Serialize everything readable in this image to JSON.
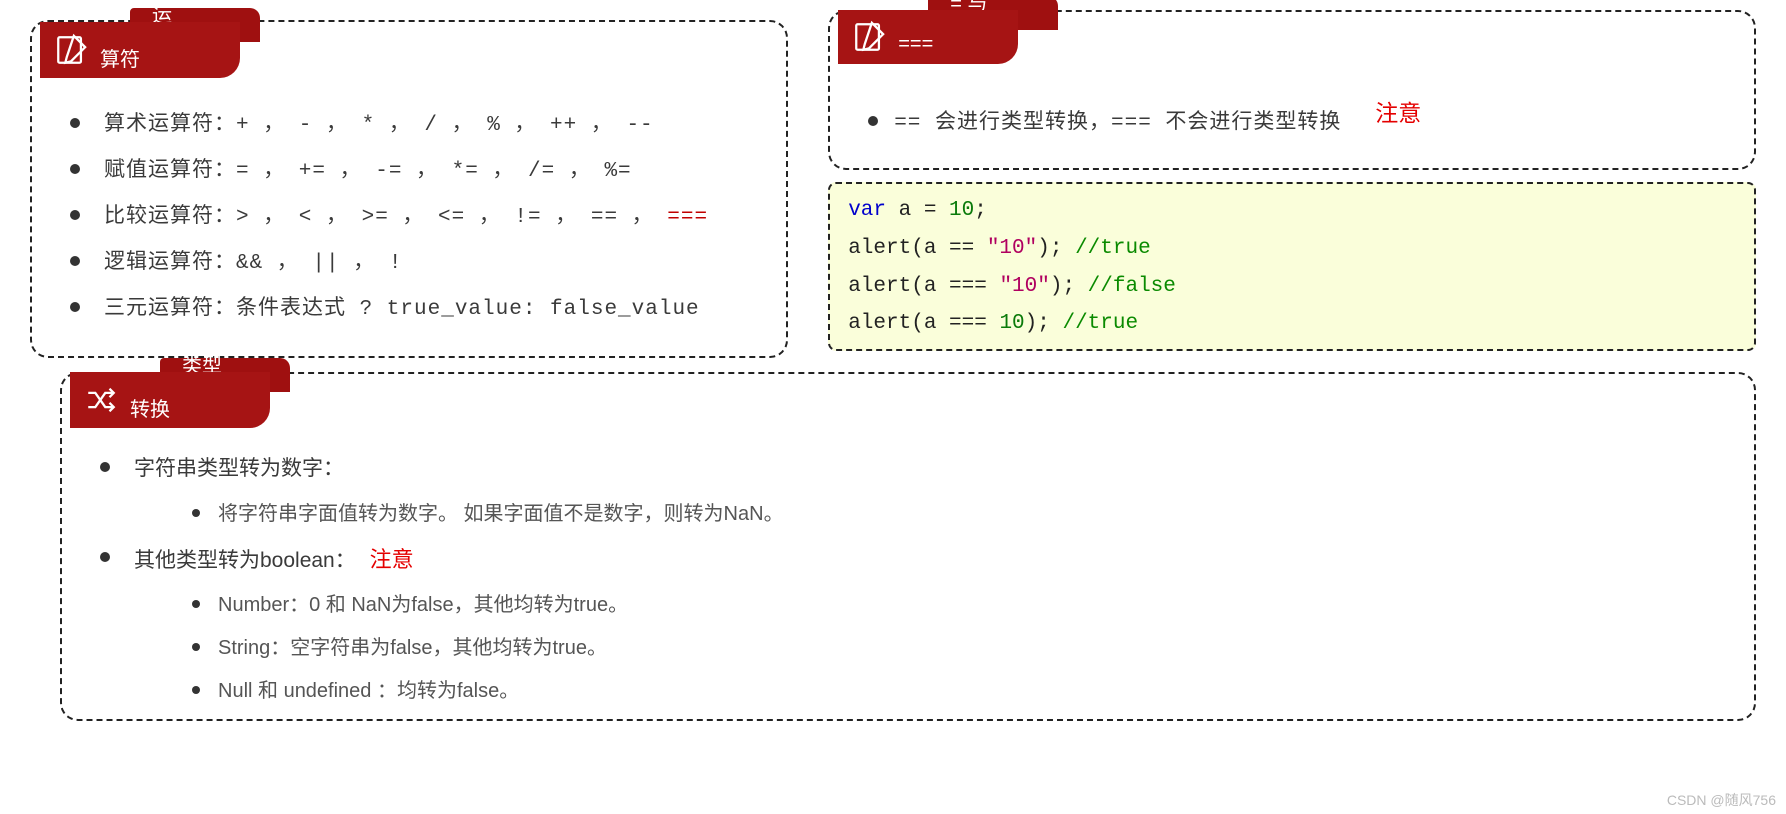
{
  "watermark": "CSDN @随风756",
  "box1": {
    "tab_back": "运",
    "tab_front": "算符",
    "items": {
      "arith_label": "算术运算符：",
      "arith_ops": "+ ， - ， * ， / ， % ， ++ ， --",
      "assign_label": "赋值运算符：",
      "assign_ops": "= ， += ， -= ， *= ， /= ， %=",
      "compare_label": "比较运算符：",
      "compare_ops_main": "> ， < ， >= ， <= ， != ， == ， ",
      "compare_ops_red": "===",
      "logic_label": "逻辑运算符：",
      "logic_ops": "&& ， || ， !",
      "ternary_label": "三元运算符：",
      "ternary_ops": "条件表达式 ? true_value: false_value"
    }
  },
  "box2": {
    "tab_back": "= 与",
    "tab_front_label": "===",
    "notice": "注意",
    "bullet": "==  会进行类型转换，===  不会进行类型转换"
  },
  "code": {
    "line1": {
      "kw": "var",
      "rest": " a = ",
      "num": "10",
      "tail": ";"
    },
    "line2": {
      "pre": "alert(a == ",
      "str": "\"10\"",
      "post": "); ",
      "cmt": "//true"
    },
    "line3": {
      "pre": "alert(a === ",
      "str": "\"10\"",
      "post": "); ",
      "cmt": "//false"
    },
    "line4": {
      "pre": "alert(a === ",
      "num": "10",
      "post": "); ",
      "cmt": "//true"
    }
  },
  "box3": {
    "tab_back": "类型",
    "tab_front": "转换",
    "notice": "注意",
    "items": {
      "str2num": "字符串类型转为数字：",
      "str2num_sub": "将字符串字面值转为数字。 如果字面值不是数字，则转为NaN。",
      "other2bool": "其他类型转为boolean：",
      "sub1": "Number：0 和 NaN为false，其他均转为true。",
      "sub2": "String：空字符串为false，其他均转为true。",
      "sub3": "Null 和 undefined ：均转为false。"
    }
  }
}
